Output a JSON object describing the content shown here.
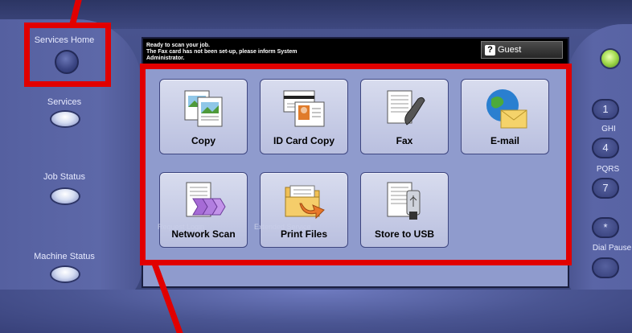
{
  "status": {
    "line1": "Ready to scan your job.",
    "line2": "The Fax card has not been set-up, please inform System",
    "line3": "Administrator.",
    "guest_label": "Guest",
    "guest_icon": "?"
  },
  "tiles": [
    {
      "label": "Copy",
      "icon": "copy-icon"
    },
    {
      "label": "ID Card Copy",
      "icon": "id-card-icon"
    },
    {
      "label": "Fax",
      "icon": "fax-icon"
    },
    {
      "label": "E-mail",
      "icon": "email-icon"
    },
    {
      "label": "Network Scan",
      "icon": "network-scan-icon"
    },
    {
      "label": "Print Files",
      "icon": "print-files-icon"
    },
    {
      "label": "Store to USB",
      "icon": "usb-icon"
    }
  ],
  "under_screen": {
    "left_text": "Request Login",
    "right_text": "Extended Service"
  },
  "left_panel": {
    "services_home": "Services Home",
    "services": "Services",
    "job_status": "Job Status",
    "machine_status": "Machine Status"
  },
  "right_panel": {
    "key1": "1",
    "label_ghi": "GHI",
    "key4": "4",
    "label_pqrs": "PQRS",
    "key7": "7",
    "key_star": "*",
    "label_dial_pause": "Dial Pause"
  },
  "colors": {
    "highlight": "#e10000",
    "panel": "#4a5590",
    "screen_bg": "#8f9bcd",
    "power_led": "#9fd84a"
  }
}
